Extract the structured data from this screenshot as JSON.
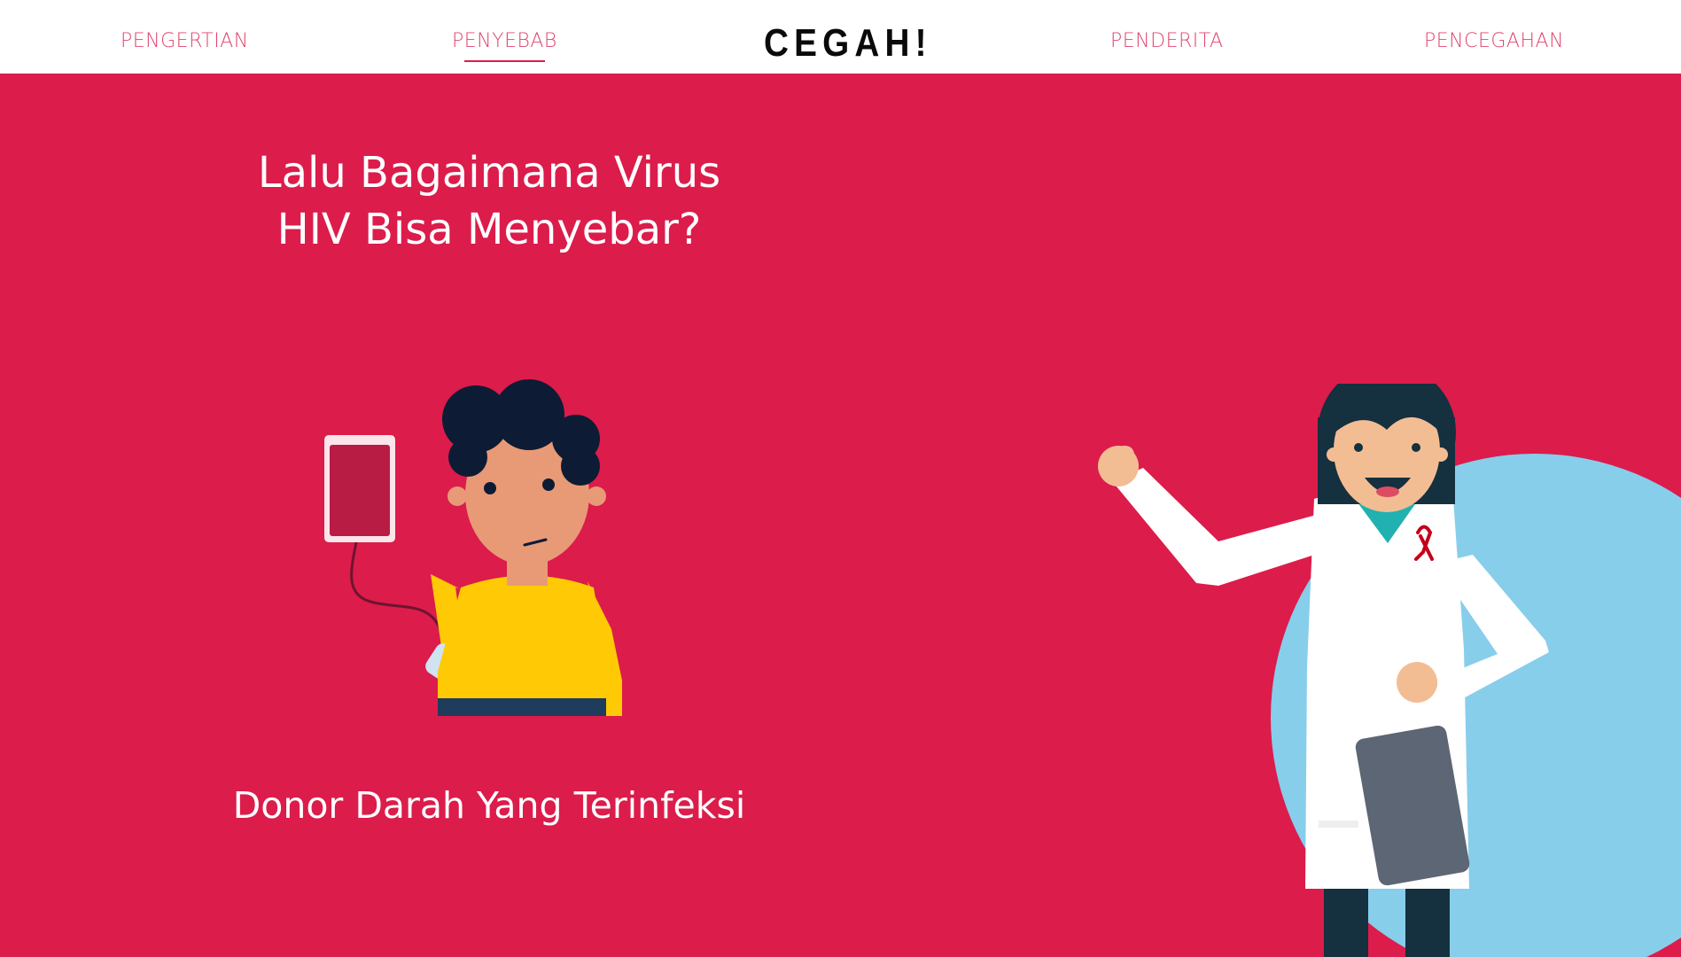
{
  "nav": {
    "items": [
      {
        "label": "PENGERTIAN",
        "active": false
      },
      {
        "label": "PENYEBAB",
        "active": true
      },
      {
        "label": "PENDERITA",
        "active": false
      },
      {
        "label": "PENCEGAHAN",
        "active": false
      }
    ],
    "logo": "CEGAH!"
  },
  "hero": {
    "title_line1": "Lalu Bagaimana Virus",
    "title_line2": "HIV Bisa Menyebar?",
    "caption": "Donor Darah Yang Terinfeksi"
  },
  "colors": {
    "primary": "#dc1c4b",
    "nav_text": "#e0466f",
    "circle": "#87ceeb"
  },
  "icons": [
    "blood-bag-icon",
    "red-ribbon-icon",
    "clipboard-icon"
  ]
}
